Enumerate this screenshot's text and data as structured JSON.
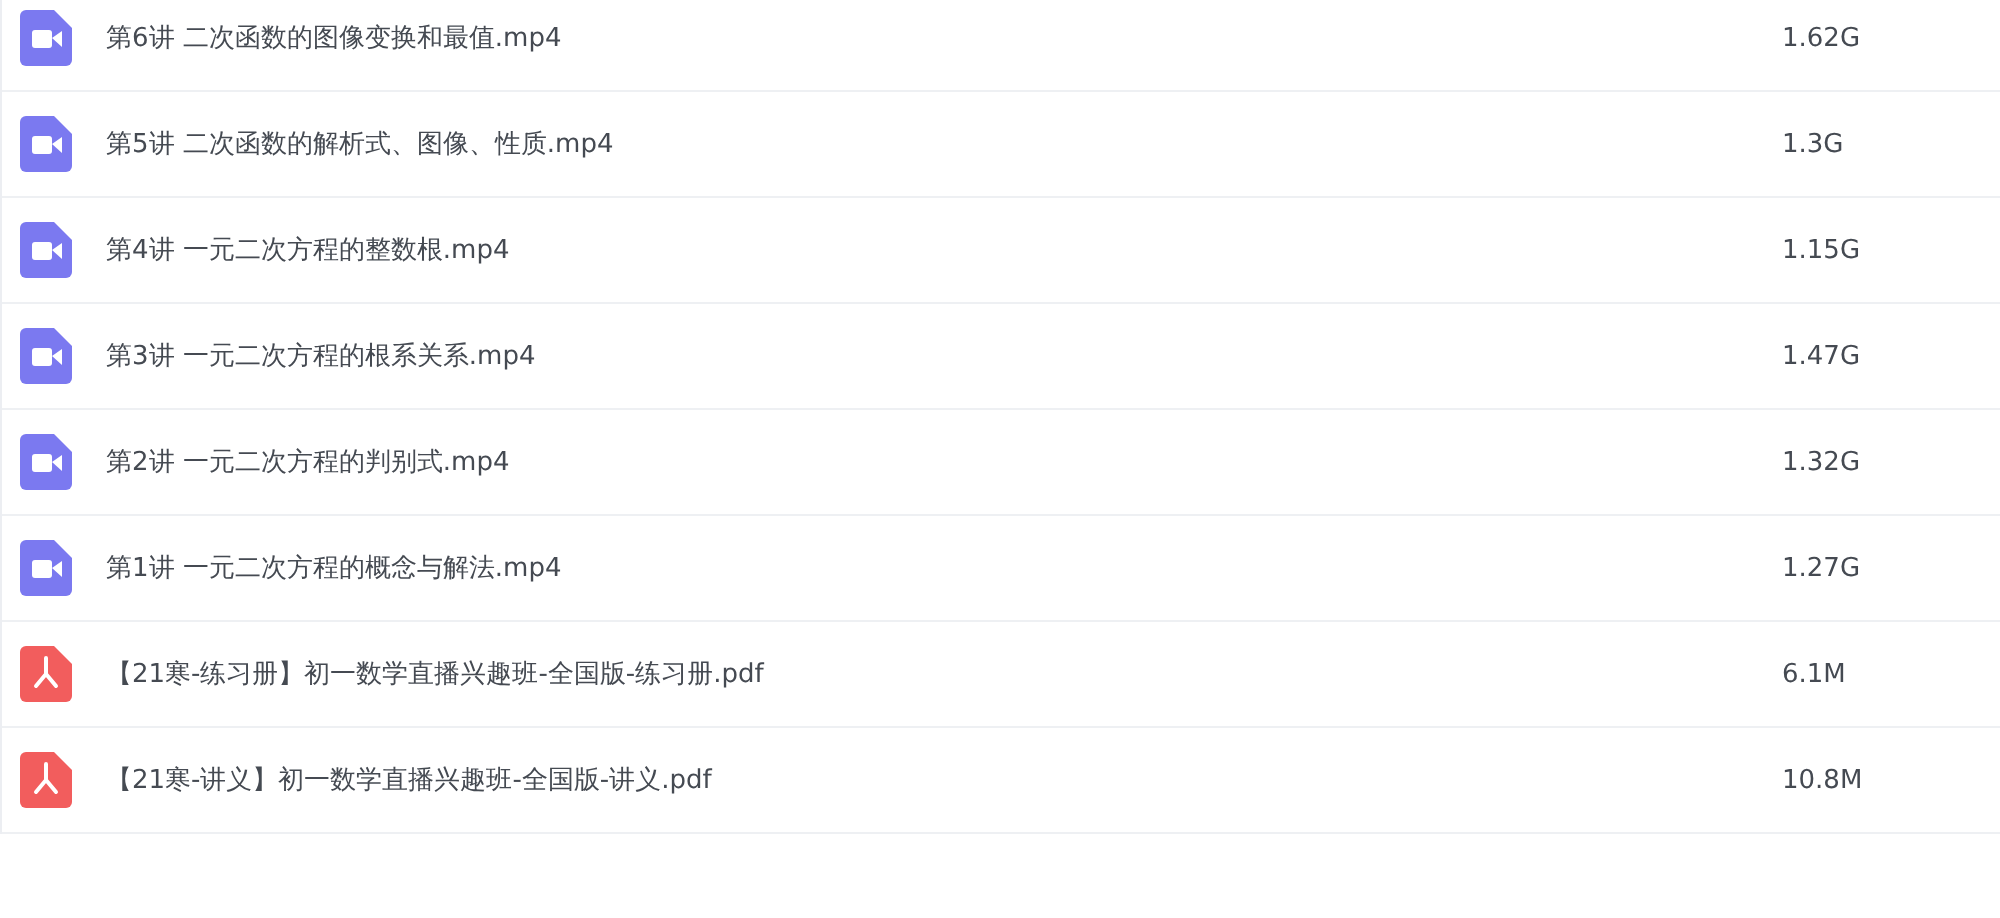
{
  "files": [
    {
      "kind": "video",
      "name": "第6讲 二次函数的图像变换和最值.mp4",
      "size": "1.62G"
    },
    {
      "kind": "video",
      "name": "第5讲 二次函数的解析式、图像、性质.mp4",
      "size": "1.3G"
    },
    {
      "kind": "video",
      "name": "第4讲 一元二次方程的整数根.mp4",
      "size": "1.15G"
    },
    {
      "kind": "video",
      "name": "第3讲 一元二次方程的根系关系.mp4",
      "size": "1.47G"
    },
    {
      "kind": "video",
      "name": "第2讲 一元二次方程的判别式.mp4",
      "size": "1.32G"
    },
    {
      "kind": "video",
      "name": "第1讲 一元二次方程的概念与解法.mp4",
      "size": "1.27G"
    },
    {
      "kind": "pdf",
      "name": "【21寒-练习册】初一数学直播兴趣班-全国版-练习册.pdf",
      "size": "6.1M"
    },
    {
      "kind": "pdf",
      "name": "【21寒-讲义】初一数学直播兴趣班-全国版-讲义.pdf",
      "size": "10.8M"
    }
  ]
}
